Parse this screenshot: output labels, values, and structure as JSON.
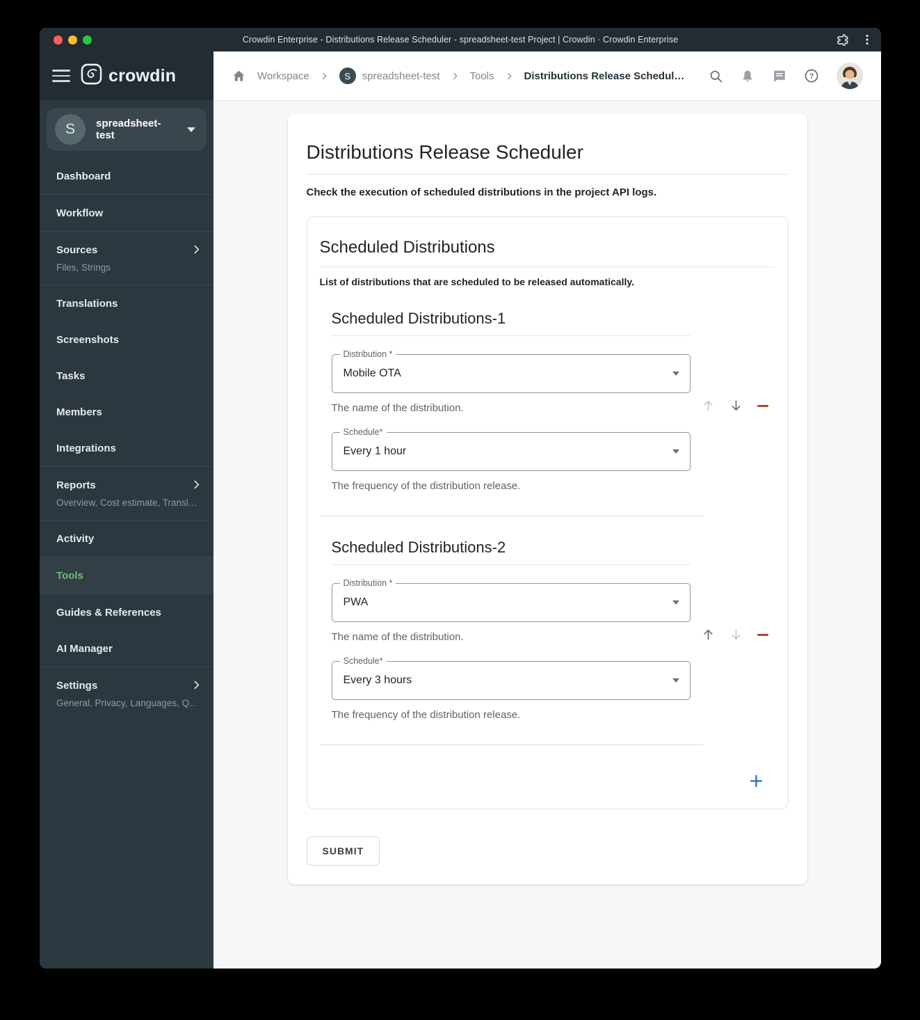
{
  "window": {
    "title": "Crowdin Enterprise - Distributions Release Scheduler - spreadsheet-test Project | Crowdin · Crowdin Enterprise"
  },
  "brand": {
    "name": "crowdin"
  },
  "project_selector": {
    "initial": "S",
    "name": "spreadsheet-test"
  },
  "sidebar": {
    "items": [
      {
        "label": "Dashboard"
      },
      {
        "label": "Workflow"
      },
      {
        "label": "Sources",
        "subtitle": "Files, Strings"
      },
      {
        "label": "Translations"
      },
      {
        "label": "Screenshots"
      },
      {
        "label": "Tasks"
      },
      {
        "label": "Members"
      },
      {
        "label": "Integrations"
      },
      {
        "label": "Reports",
        "subtitle": "Overview, Cost estimate, Transl…"
      },
      {
        "label": "Activity"
      },
      {
        "label": "Tools"
      },
      {
        "label": "Guides & References"
      },
      {
        "label": "AI Manager"
      },
      {
        "label": "Settings",
        "subtitle": "General, Privacy, Languages, Q…"
      }
    ]
  },
  "breadcrumb": {
    "project_initial": "S",
    "items": [
      "Workspace",
      "spreadsheet-test",
      "Tools",
      "Distributions Release Schedul…"
    ]
  },
  "page": {
    "title": "Distributions Release Scheduler",
    "subtitle": "Check the execution of scheduled distributions in the project API logs.",
    "card": {
      "title": "Scheduled Distributions",
      "description": "List of distributions that are scheduled to be released automatically.",
      "required_indicator": "*",
      "groups": [
        {
          "title": "Scheduled Distributions-1",
          "fields": [
            {
              "label": "Distribution",
              "value": "Mobile OTA",
              "helper": "The name of the distribution."
            },
            {
              "label": "Schedule",
              "value": "Every 1 hour",
              "helper": "The frequency of the distribution release."
            }
          ]
        },
        {
          "title": "Scheduled Distributions-2",
          "fields": [
            {
              "label": "Distribution",
              "value": "PWA",
              "helper": "The name of the distribution."
            },
            {
              "label": "Schedule",
              "value": "Every 3 hours",
              "helper": "The frequency of the distribution release."
            }
          ]
        }
      ]
    },
    "submit_label": "SUBMIT"
  },
  "icons": [
    "traffic-light-close",
    "traffic-light-minimize",
    "traffic-light-zoom",
    "extensions-puzzle-icon",
    "browser-menu-icon",
    "hamburger-menu-icon",
    "crowdin-logo-icon",
    "chevron-down-icon",
    "chevron-right-icon",
    "home-icon",
    "search-icon",
    "bell-icon",
    "messages-icon",
    "help-icon",
    "user-avatar",
    "dropdown-caret-icon",
    "move-up-icon",
    "move-down-icon",
    "remove-minus-icon",
    "add-plus-icon"
  ],
  "colors": {
    "titlebar_bg": "#222c32",
    "sidebar_bg": "#2b3840",
    "active_green": "#6fbc73",
    "add_blue": "#1d6fc2",
    "remove_red": "#bd3d32",
    "page_bg": "#f5f7f8"
  }
}
